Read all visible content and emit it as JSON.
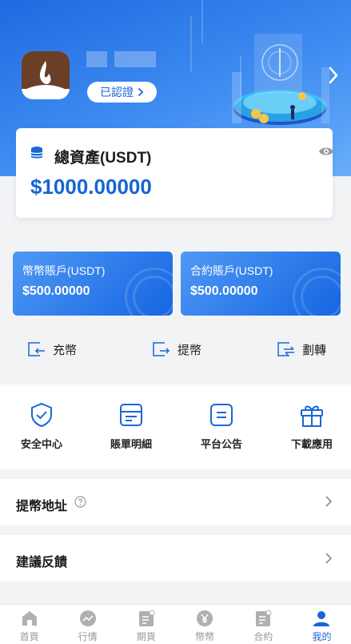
{
  "header": {
    "verified_label": "已認證",
    "colors": {
      "primary": "#1766d6",
      "header_gradient_start": "#1f6ae0",
      "header_gradient_end": "#69aef8"
    }
  },
  "assets": {
    "title": "總資產(USDT)",
    "value": "$1000.00000"
  },
  "accounts": [
    {
      "label": "幣幣賬戶(USDT)",
      "value": "$500.00000"
    },
    {
      "label": "合約賬戶(USDT)",
      "value": "$500.00000"
    }
  ],
  "actions": [
    {
      "label": "充幣",
      "icon": "deposit-icon"
    },
    {
      "label": "提幣",
      "icon": "withdraw-icon"
    },
    {
      "label": "劃轉",
      "icon": "transfer-icon"
    }
  ],
  "features": [
    {
      "label": "安全中心",
      "icon": "shield-check-icon"
    },
    {
      "label": "賬單明細",
      "icon": "bill-icon"
    },
    {
      "label": "平台公告",
      "icon": "announcement-icon"
    },
    {
      "label": "下載應用",
      "icon": "gift-icon"
    }
  ],
  "menu": [
    {
      "label": "提幣地址",
      "icon": "help-icon"
    },
    {
      "label": "建議反饋"
    }
  ],
  "tabbar": {
    "active_index": 5,
    "tabs": [
      {
        "label": "首頁",
        "icon": "home-icon"
      },
      {
        "label": "行情",
        "icon": "market-icon"
      },
      {
        "label": "期貨",
        "icon": "futures-icon"
      },
      {
        "label": "幣幣",
        "icon": "coin-icon"
      },
      {
        "label": "合約",
        "icon": "contract-icon"
      },
      {
        "label": "我的",
        "icon": "user-icon"
      }
    ]
  }
}
